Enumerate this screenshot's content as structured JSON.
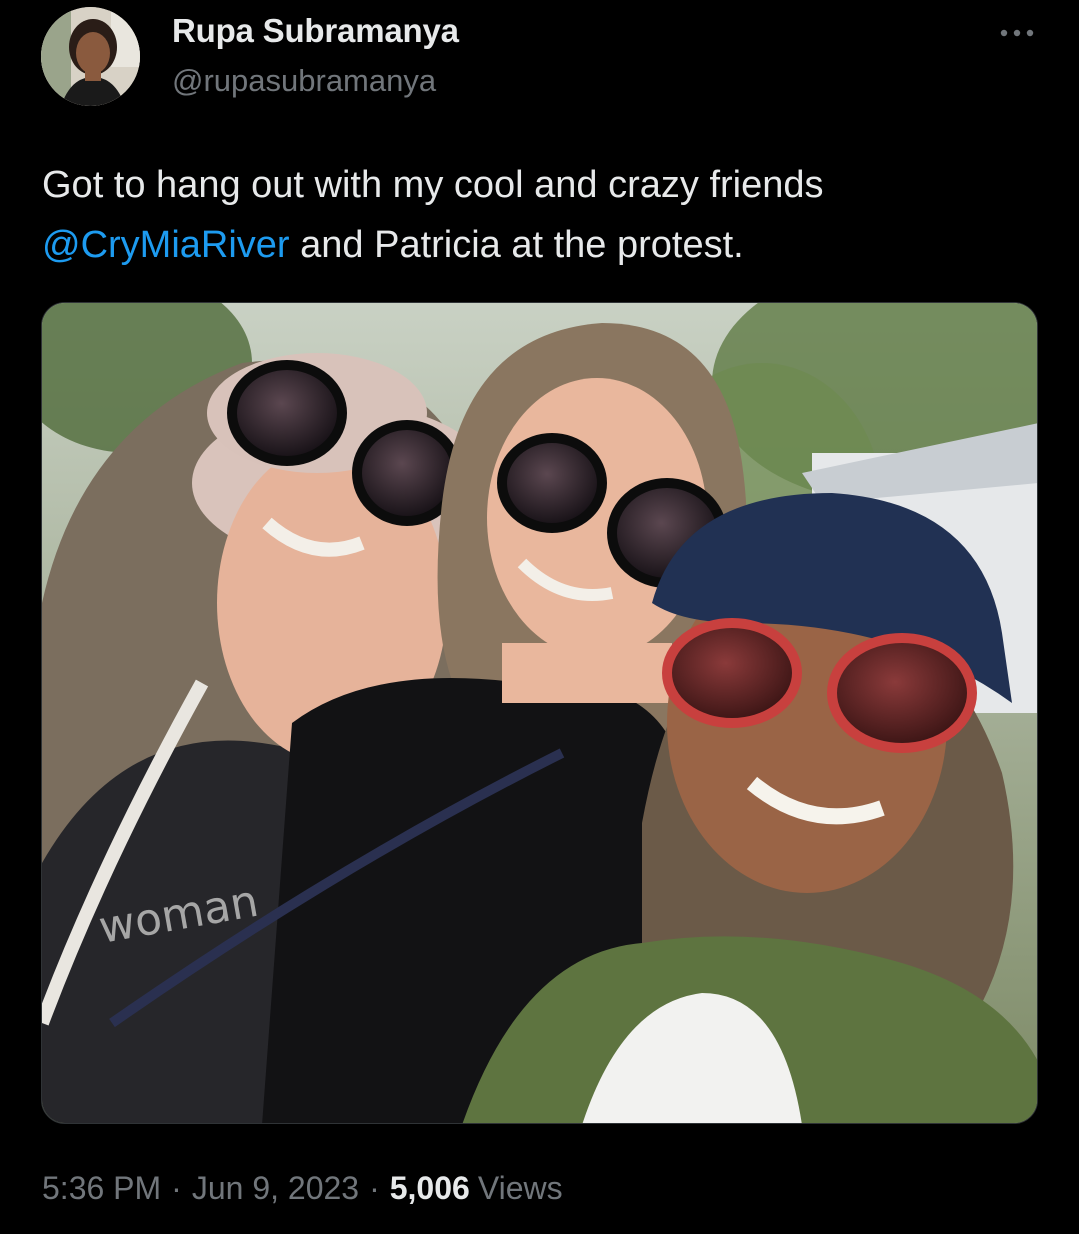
{
  "tweet": {
    "author": {
      "display_name": "Rupa Subramanya",
      "handle": "@rupasubramanya"
    },
    "text_before": "Got to hang out with my cool and crazy friends",
    "mention": "@CryMiaRiver",
    "text_after": " and Patricia at the protest.",
    "photo": {
      "shirt_text": "woman"
    },
    "meta": {
      "time": "5:36 PM",
      "separator": "·",
      "date": "Jun 9, 2023",
      "views_count": "5,006",
      "views_label": "Views"
    }
  },
  "icons": {
    "more": "more-horizontal-icon"
  },
  "colors": {
    "background": "#000000",
    "text_primary": "#e7e9ea",
    "text_secondary": "#71767b",
    "link": "#1d9bf0"
  }
}
